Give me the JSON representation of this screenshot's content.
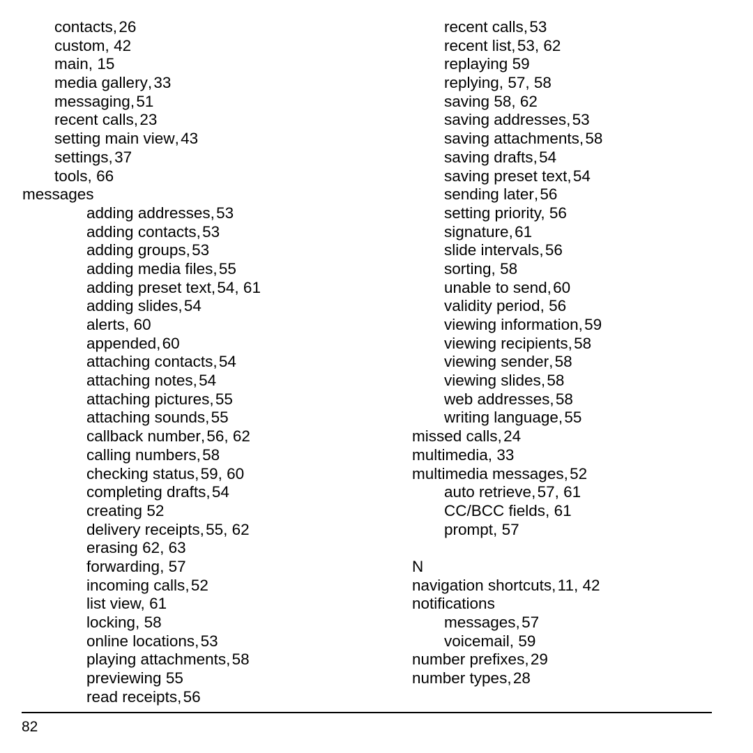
{
  "page": {
    "number": "82",
    "kind": "index"
  },
  "columns": [
    {
      "name": "left",
      "entries": [
        {
          "level": 1,
          "term": "contacts",
          "sep": ",",
          "pages": "26",
          "tight": true
        },
        {
          "level": 1,
          "term": "custom",
          "sep": ",",
          "pages": "42",
          "tight": false
        },
        {
          "level": 1,
          "term": "main",
          "sep": ",",
          "pages": "15",
          "tight": false
        },
        {
          "level": 1,
          "term": "media gallery",
          "sep": ",",
          "pages": "33",
          "tight": true
        },
        {
          "level": 1,
          "term": "messaging",
          "sep": ",",
          "pages": "51",
          "tight": true
        },
        {
          "level": 1,
          "term": "recent calls",
          "sep": ",",
          "pages": "23",
          "tight": true
        },
        {
          "level": 1,
          "term": "setting main view",
          "sep": ",",
          "pages": "43",
          "tight": true
        },
        {
          "level": 1,
          "term": "settings",
          "sep": ",",
          "pages": "37",
          "tight": true
        },
        {
          "level": 1,
          "term": "tools",
          "sep": ",",
          "pages": "66",
          "tight": false
        },
        {
          "level": 0,
          "term": "messages",
          "sep": "",
          "pages": "",
          "tight": false
        },
        {
          "level": 2,
          "term": "adding addresses",
          "sep": ",",
          "pages": "53",
          "tight": true
        },
        {
          "level": 2,
          "term": "adding contacts",
          "sep": ",",
          "pages": "53",
          "tight": true
        },
        {
          "level": 2,
          "term": "adding groups",
          "sep": ",",
          "pages": "53",
          "tight": true
        },
        {
          "level": 2,
          "term": "adding media files",
          "sep": ",",
          "pages": "55",
          "tight": true
        },
        {
          "level": 2,
          "term": "adding preset text",
          "sep": ",",
          "pages": "54, 61",
          "tight": true
        },
        {
          "level": 2,
          "term": "adding slides",
          "sep": ",",
          "pages": "54",
          "tight": true
        },
        {
          "level": 2,
          "term": "alerts",
          "sep": ",",
          "pages": "60",
          "tight": false
        },
        {
          "level": 2,
          "term": "appended",
          "sep": ",",
          "pages": "60",
          "tight": true
        },
        {
          "level": 2,
          "term": "attaching contacts",
          "sep": ",",
          "pages": "54",
          "tight": true
        },
        {
          "level": 2,
          "term": "attaching notes",
          "sep": ",",
          "pages": "54",
          "tight": true
        },
        {
          "level": 2,
          "term": "attaching pictures",
          "sep": ",",
          "pages": "55",
          "tight": true
        },
        {
          "level": 2,
          "term": "attaching sounds",
          "sep": ",",
          "pages": "55",
          "tight": true
        },
        {
          "level": 2,
          "term": "callback number",
          "sep": ",",
          "pages": "56, 62",
          "tight": true
        },
        {
          "level": 2,
          "term": "calling numbers",
          "sep": ",",
          "pages": "58",
          "tight": true
        },
        {
          "level": 2,
          "term": "checking status",
          "sep": ",",
          "pages": "59, 60",
          "tight": true
        },
        {
          "level": 2,
          "term": "completing drafts",
          "sep": ",",
          "pages": "54",
          "tight": true
        },
        {
          "level": 2,
          "term": "creating",
          "sep": "",
          "pages": "52",
          "tight": false
        },
        {
          "level": 2,
          "term": "delivery receipts",
          "sep": ",",
          "pages": "55, 62",
          "tight": true
        },
        {
          "level": 2,
          "term": "erasing",
          "sep": "",
          "pages": "62, 63",
          "tight": false
        },
        {
          "level": 2,
          "term": "forwarding",
          "sep": ",",
          "pages": "57",
          "tight": false
        },
        {
          "level": 2,
          "term": "incoming calls",
          "sep": ",",
          "pages": "52",
          "tight": true
        },
        {
          "level": 2,
          "term": "list view",
          "sep": ",",
          "pages": "61",
          "tight": false
        },
        {
          "level": 2,
          "term": "locking",
          "sep": ",",
          "pages": "58",
          "tight": false
        },
        {
          "level": 2,
          "term": "online locations",
          "sep": ",",
          "pages": "53",
          "tight": true
        },
        {
          "level": 2,
          "term": "playing attachments",
          "sep": ",",
          "pages": "58",
          "tight": true
        },
        {
          "level": 2,
          "term": "previewing",
          "sep": "",
          "pages": "55",
          "tight": false
        },
        {
          "level": 2,
          "term": "read receipts",
          "sep": ",",
          "pages": "56",
          "tight": true
        }
      ]
    },
    {
      "name": "right",
      "entries": [
        {
          "level": 2,
          "term": "recent calls",
          "sep": ",",
          "pages": "53",
          "tight": true
        },
        {
          "level": 2,
          "term": "recent list",
          "sep": ",",
          "pages": "53, 62",
          "tight": true
        },
        {
          "level": 2,
          "term": "replaying",
          "sep": "",
          "pages": "59",
          "tight": false
        },
        {
          "level": 2,
          "term": "replying",
          "sep": ",",
          "pages": "57, 58",
          "tight": false
        },
        {
          "level": 2,
          "term": "saving",
          "sep": "",
          "pages": "58, 62",
          "tight": false
        },
        {
          "level": 2,
          "term": "saving addresses",
          "sep": ",",
          "pages": "53",
          "tight": true
        },
        {
          "level": 2,
          "term": "saving attachments",
          "sep": ",",
          "pages": "58",
          "tight": true
        },
        {
          "level": 2,
          "term": "saving drafts",
          "sep": ",",
          "pages": "54",
          "tight": true
        },
        {
          "level": 2,
          "term": "saving preset text",
          "sep": ",",
          "pages": "54",
          "tight": true
        },
        {
          "level": 2,
          "term": "sending later",
          "sep": ",",
          "pages": "56",
          "tight": true
        },
        {
          "level": 2,
          "term": "setting priority",
          "sep": ",",
          "pages": "56",
          "tight": false
        },
        {
          "level": 2,
          "term": "signature",
          "sep": ",",
          "pages": "61",
          "tight": true
        },
        {
          "level": 2,
          "term": "slide intervals",
          "sep": ",",
          "pages": "56",
          "tight": true
        },
        {
          "level": 2,
          "term": "sorting",
          "sep": ",",
          "pages": "58",
          "tight": false
        },
        {
          "level": 2,
          "term": "unable to send",
          "sep": ",",
          "pages": "60",
          "tight": true
        },
        {
          "level": 2,
          "term": "validity period",
          "sep": ",",
          "pages": "56",
          "tight": false
        },
        {
          "level": 2,
          "term": "viewing information",
          "sep": ",",
          "pages": "59",
          "tight": true
        },
        {
          "level": 2,
          "term": "viewing recipients",
          "sep": ",",
          "pages": "58",
          "tight": true
        },
        {
          "level": 2,
          "term": "viewing sender",
          "sep": ",",
          "pages": "58",
          "tight": true
        },
        {
          "level": 2,
          "term": "viewing slides",
          "sep": ",",
          "pages": "58",
          "tight": true
        },
        {
          "level": 2,
          "term": "web addresses",
          "sep": ",",
          "pages": "58",
          "tight": true
        },
        {
          "level": 2,
          "term": "writing language",
          "sep": ",",
          "pages": "55",
          "tight": true
        },
        {
          "level": 1,
          "term": "missed calls",
          "sep": ",",
          "pages": "24",
          "tight": true
        },
        {
          "level": 1,
          "term": "multimedia",
          "sep": ",",
          "pages": "33",
          "tight": false
        },
        {
          "level": 1,
          "term": "multimedia messages",
          "sep": ",",
          "pages": "52",
          "tight": true
        },
        {
          "level": 2,
          "term": "auto retrieve",
          "sep": ",",
          "pages": "57, 61",
          "tight": true
        },
        {
          "level": 2,
          "term": "CC/BCC fields",
          "sep": ",",
          "pages": "61",
          "tight": false
        },
        {
          "level": 2,
          "term": "prompt",
          "sep": ",",
          "pages": "57",
          "tight": false
        },
        {
          "level": 1,
          "term": "",
          "sep": "",
          "pages": "",
          "tight": false
        },
        {
          "level": 1,
          "term": "N",
          "sep": "",
          "pages": "",
          "tight": false
        },
        {
          "level": 1,
          "term": "navigation shortcuts",
          "sep": ",",
          "pages": "11, 42",
          "tight": true
        },
        {
          "level": 1,
          "term": "notifications",
          "sep": "",
          "pages": "",
          "tight": false
        },
        {
          "level": 2,
          "term": "messages",
          "sep": ",",
          "pages": "57",
          "tight": true
        },
        {
          "level": 2,
          "term": "voicemail",
          "sep": ",",
          "pages": "59",
          "tight": false
        },
        {
          "level": 1,
          "term": "number prefixes",
          "sep": ",",
          "pages": "29",
          "tight": true
        },
        {
          "level": 1,
          "term": "number types",
          "sep": ",",
          "pages": "28",
          "tight": true
        }
      ]
    }
  ]
}
